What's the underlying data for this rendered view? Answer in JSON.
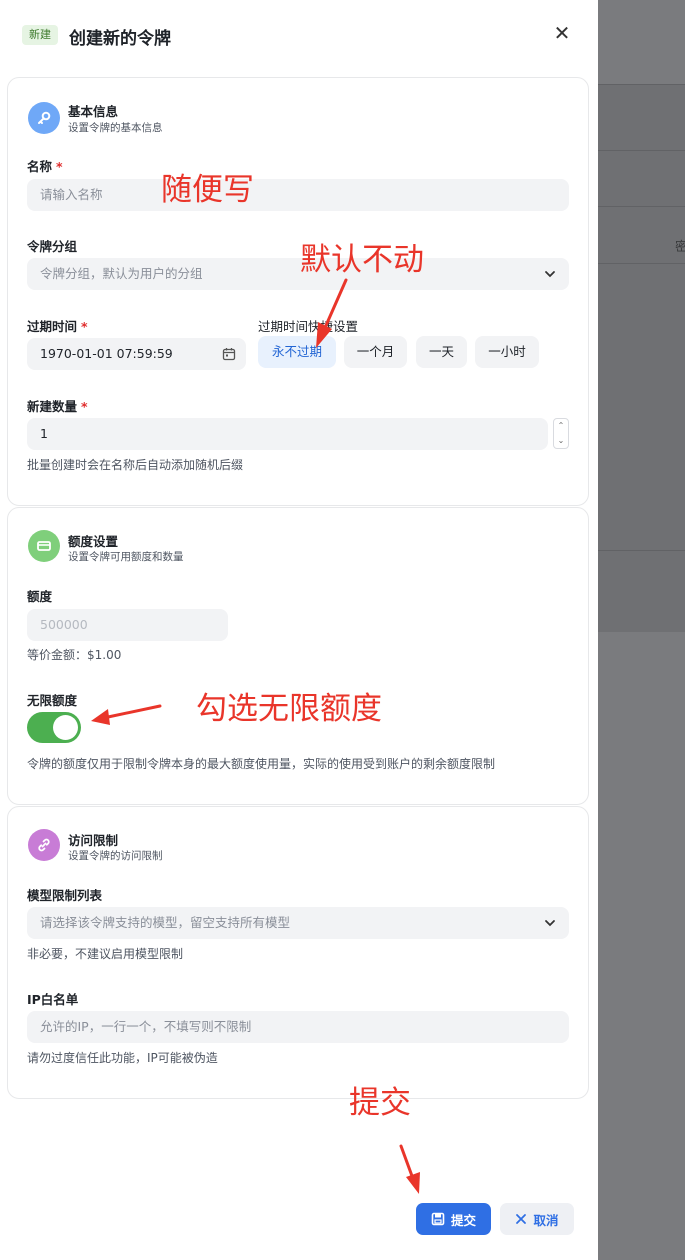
{
  "header": {
    "tag": "新建",
    "title": "创建新的令牌",
    "close_icon": "close-icon"
  },
  "basic": {
    "title": "基本信息",
    "subtitle": "设置令牌的基本信息",
    "icon": "key-icon",
    "name_label": "名称",
    "name_placeholder": "请输入名称",
    "group_label": "令牌分组",
    "group_placeholder": "令牌分组，默认为用户的分组",
    "expire_label": "过期时间",
    "expire_value": "1970-01-01 07:59:59",
    "quick_label": "过期时间快捷设置",
    "quick_options": [
      "永不过期",
      "一个月",
      "一天",
      "一小时"
    ],
    "count_label": "新建数量",
    "count_value": "1",
    "count_hint": "批量创建时会在名称后自动添加随机后缀"
  },
  "quota": {
    "title": "额度设置",
    "subtitle": "设置令牌可用额度和数量",
    "icon": "card-icon",
    "quota_label": "额度",
    "quota_value": "500000",
    "equiv": "等价金额：$1.00",
    "unlimited_label": "无限额度",
    "unlimited_on": true,
    "note": "令牌的额度仅用于限制令牌本身的最大额度使用量，实际的使用受到账户的剩余额度限制"
  },
  "access": {
    "title": "访问限制",
    "subtitle": "设置令牌的访问限制",
    "icon": "link-icon",
    "model_label": "模型限制列表",
    "model_placeholder": "请选择该令牌支持的模型，留空支持所有模型",
    "model_hint": "非必要，不建议启用模型限制",
    "ip_label": "IP白名单",
    "ip_placeholder": "允许的IP，一行一个，不填写则不限制",
    "ip_hint": "请勿过度信任此功能，IP可能被伪造"
  },
  "footer": {
    "submit": "提交",
    "cancel": "取消"
  },
  "annotations": {
    "name": "随便写",
    "group": "默认不动",
    "unlimited": "勾选无限额度",
    "submit": "提交"
  },
  "backdrop": {
    "partial_text": "密"
  },
  "colors": {
    "primary": "#2f6fe4",
    "toggle_on": "#4caf50",
    "annotation": "#e9352a",
    "required": "#e02d2d"
  }
}
